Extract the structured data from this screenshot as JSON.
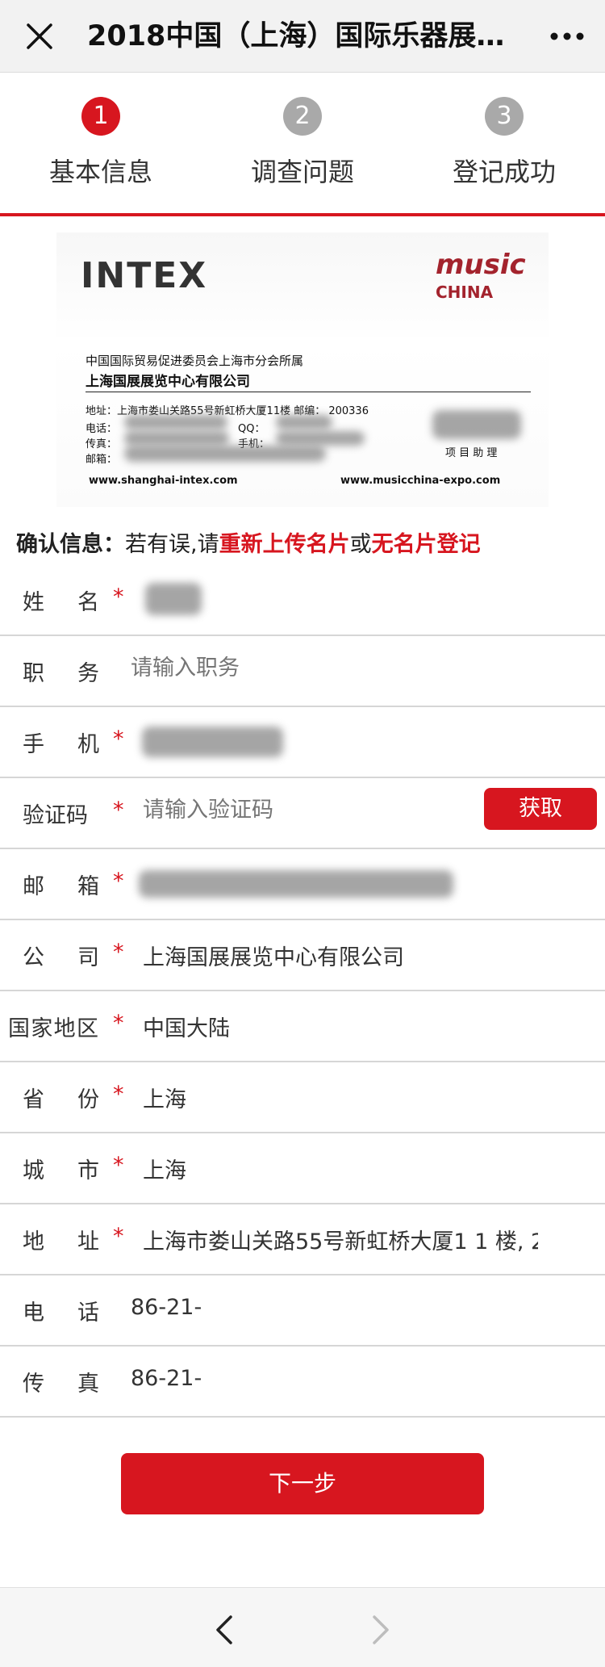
{
  "title_bar": {
    "title": "2018中国（上海）国际乐器展…",
    "close_icon": "close-icon",
    "more_icon": "more-icon"
  },
  "steps": [
    {
      "num": "1",
      "label": "基本信息",
      "active": true
    },
    {
      "num": "2",
      "label": "调查问题",
      "active": false
    },
    {
      "num": "3",
      "label": "登记成功",
      "active": false
    }
  ],
  "card": {
    "brand_left": "INTEX",
    "brand_right_top": "music",
    "brand_right_bottom": "CHINA",
    "org_line1": "中国国际贸易促进委员会上海市分会所属",
    "org_line2": "上海国展展览中心有限公司",
    "address_line": "地址：上海市娄山关路55号新虹桥大厦11楼  邮编：  200336",
    "phone_label": "电话：",
    "qq_label": "QQ：",
    "fax_label": "传真：",
    "mobile_label": "手机：",
    "email_label": "邮箱：",
    "job_title": "项 目 助 理",
    "url_left": "www.shanghai-intex.com",
    "url_right": "www.musicchina-expo.com"
  },
  "confirm": {
    "label": "确认信息：",
    "text1": "若有误,请",
    "link1": "重新上传名片",
    "text2": "或",
    "link2": "无名片登记"
  },
  "form": {
    "name_label": "姓名",
    "position_label": "职务",
    "position_placeholder": "请输入职务",
    "mobile_label": "手机",
    "code_label": "验证码",
    "code_placeholder": "请输入验证码",
    "get_code_button": "获取",
    "email_label": "邮箱",
    "company_label": "公司",
    "company_value": "上海国展展览中心有限公司",
    "region_label": "国家地区",
    "region_value": "中国大陆",
    "province_label": "省份",
    "province_value": "上海",
    "city_label": "城市",
    "city_value": "上海",
    "address_label": "地址",
    "address_value": "上海市娄山关路55号新虹桥大厦1 1 楼, 2",
    "phone_label": "电话",
    "phone_value": "86-21-",
    "fax_label": "传真",
    "fax_value": "86-21-",
    "required_mark": "*"
  },
  "next_button": "下一步",
  "colors": {
    "accent": "#d7161f",
    "inactive_step": "#a9a9a9",
    "placeholder": "#bcbcbc"
  }
}
